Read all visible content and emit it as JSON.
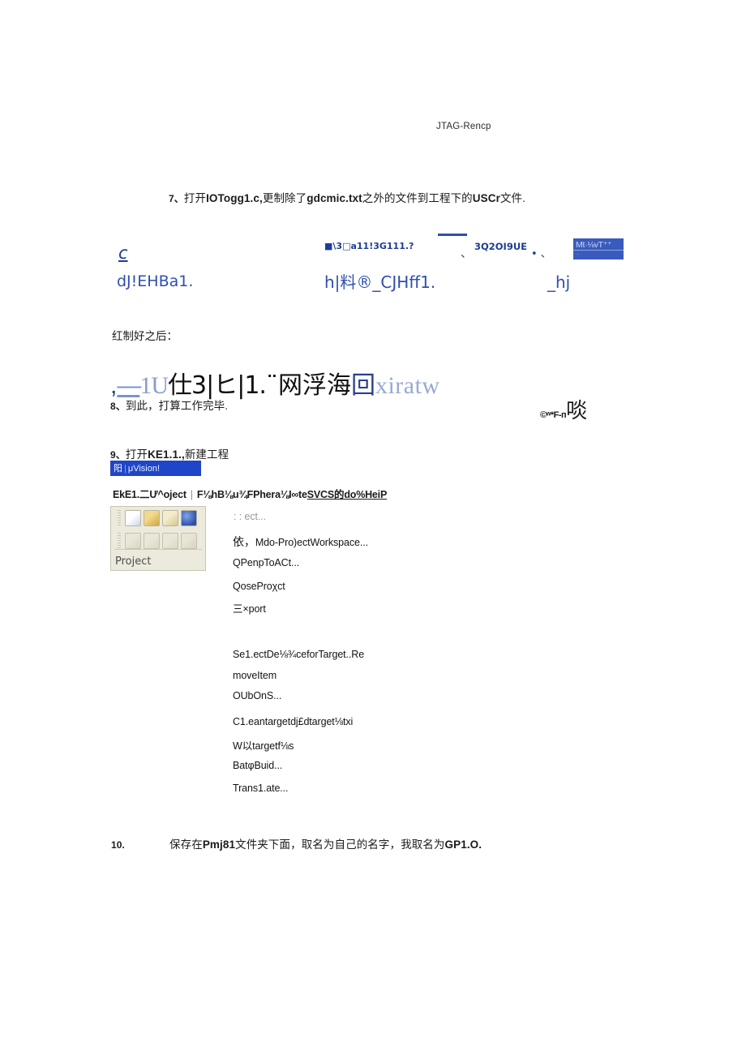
{
  "header": {
    "title": "JTAG-Rencp"
  },
  "steps": {
    "step7": {
      "number": "7、",
      "text_a": "打开",
      "bold_a": "IOTogg1.c,",
      "text_b": "更制除了",
      "bold_b": "gdcmic.txt",
      "text_c": "之外的文件到工程下的",
      "bold_c": "USCr",
      "text_d": "文件."
    },
    "step8": {
      "number": "8、",
      "text": "到此，打算工作完毕."
    },
    "step9": {
      "number": "9、",
      "text_a": "打开",
      "bold_a": "KE1.1.,",
      "text_b": "新建工程"
    },
    "step10": {
      "number": "10.",
      "text_a": "保存在",
      "bold_a": "Pmj81",
      "text_b": "文件夹下面，取名为自己的名字，我取名为",
      "bold_b": "GP1.O."
    }
  },
  "captions": {
    "after_copy": "红制好之后："
  },
  "figure1": {
    "frag_c": "c",
    "frag_du": "dJ!EHBa1.",
    "frag_slash": "■\\3□a11!3G111.?",
    "frag_hcjh": "h|料®_CJHff1.",
    "frag_tick1": "、",
    "frag_3q": "3Q2OI9UE",
    "frag_dots": "• 、",
    "frag_hj": "_hj",
    "box_line1": "Mt·⅛vT⁺⁺",
    "box_line2": "·"
  },
  "figure2": {
    "comma": ",",
    "dash": "—",
    "ten": "1U",
    "cjk_a": "仕3|ヒ|1.",
    "cjk_b": "¨网浮海",
    "boxglyph": "回",
    "xiratw": "xiratw"
  },
  "stamp": {
    "mark": "©ʷ*F-ᴨ",
    "glyph": "啖"
  },
  "app": {
    "titlebar": {
      "logo": "阳",
      "separator": "|",
      "title": "μVision!"
    },
    "menubar": {
      "left": "EkE1.二Ư^oject",
      "separator": "|",
      "right_plain": "F⅛hB⅛u¾FPhera⅛I∞te",
      "right_underlined": "SVCS的do%HeiP"
    },
    "toolbar": {
      "label": "Project",
      "icons": [
        "new-file-icon",
        "open-folder-icon",
        "save-icon",
        "globe-icon",
        "target-options-icon",
        "build-icon",
        "rebuild-icon",
        "translate-icon"
      ]
    },
    "menu_items": [
      {
        "prefix": "",
        "label": ":  : ect...",
        "ghost": true
      },
      {
        "prefix": "依，",
        "label": "Mdo-Pro)ectWorkspace...",
        "ghost": false
      },
      {
        "prefix": "",
        "label": "QPenpToACt...",
        "ghost": false
      },
      {
        "prefix": "",
        "label": "QoseProχct",
        "ghost": false
      },
      {
        "prefix": "",
        "label": "三×port",
        "ghost": false
      },
      {
        "prefix": "",
        "label": "Se1.ectDe⅛¾ceforTarget..Re",
        "ghost": false
      },
      {
        "prefix": "",
        "label": "moveItem",
        "ghost": false
      },
      {
        "prefix": "",
        "label": "OUbOnS...",
        "ghost": false
      },
      {
        "prefix": "",
        "label": "C1.eantargetdj£dtarget⅛txi",
        "ghost": false
      },
      {
        "prefix": "",
        "label": "W以targetf⅛s",
        "ghost": false
      },
      {
        "prefix": "",
        "label": "BatφBuid...",
        "ghost": false
      },
      {
        "prefix": "",
        "label": "Trans1.ate...",
        "ghost": false
      }
    ]
  },
  "colors": {
    "ink": "#1b1b1b",
    "blue_frag": "#2f4fae",
    "blue_dark": "#1f3d96",
    "title_bar": "#1f46c8",
    "toolbar_bg": "#eceadd"
  }
}
